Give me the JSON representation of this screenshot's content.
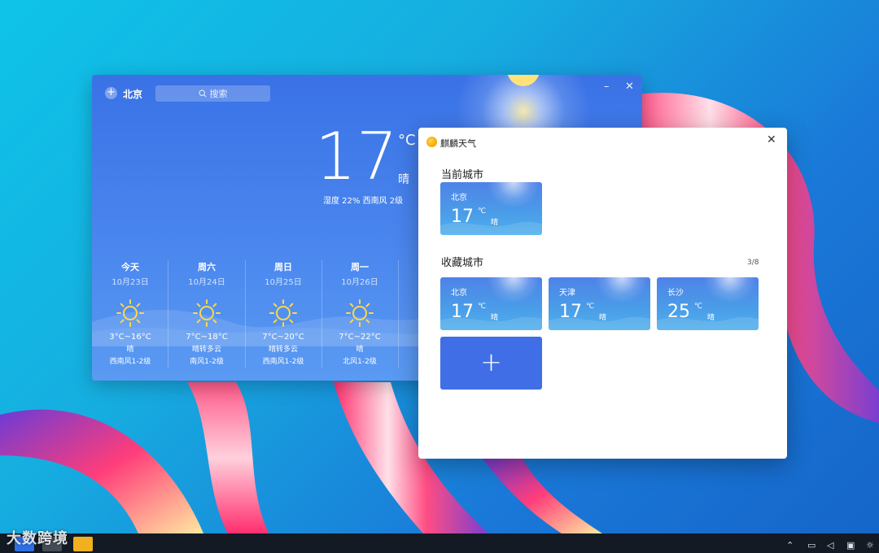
{
  "main_window": {
    "city": "北京",
    "search_placeholder": "搜索",
    "temperature": "17",
    "unit": "°C",
    "condition": "晴",
    "details": "湿度 22%   西南风 2级",
    "forecast": [
      {
        "weekday": "今天",
        "date": "10月23日",
        "range": "3°C~16°C",
        "condition": "晴",
        "wind": "西南风1-2级"
      },
      {
        "weekday": "周六",
        "date": "10月24日",
        "range": "7°C~18°C",
        "condition": "晴转多云",
        "wind": "南风1-2级"
      },
      {
        "weekday": "周日",
        "date": "10月25日",
        "range": "7°C~20°C",
        "condition": "晴转多云",
        "wind": "西南风1-2级"
      },
      {
        "weekday": "周一",
        "date": "10月26日",
        "range": "7°C~22°C",
        "condition": "晴",
        "wind": "北风1-2级"
      }
    ]
  },
  "dialog": {
    "title": "麒麟天气",
    "current_city_label": "当前城市",
    "favorites_label": "收藏城市",
    "favorites_count": "3/8",
    "current_city": {
      "name": "北京",
      "temp": "17",
      "unit": "℃",
      "condition": "晴"
    },
    "favorites": [
      {
        "name": "北京",
        "temp": "17",
        "unit": "℃",
        "condition": "晴"
      },
      {
        "name": "天津",
        "temp": "17",
        "unit": "℃",
        "condition": "晴"
      },
      {
        "name": "长沙",
        "temp": "25",
        "unit": "℃",
        "condition": "晴"
      }
    ],
    "add_symbol": "+"
  },
  "watermark": "大数跨境",
  "icons": [
    "add-city-icon",
    "search-icon",
    "minimize-icon",
    "close-icon",
    "sun-icon",
    "weather-logo-icon",
    "plus-icon"
  ],
  "colors": {
    "accent": "#3f6ee6",
    "weather_bg": "#3a72e6"
  }
}
